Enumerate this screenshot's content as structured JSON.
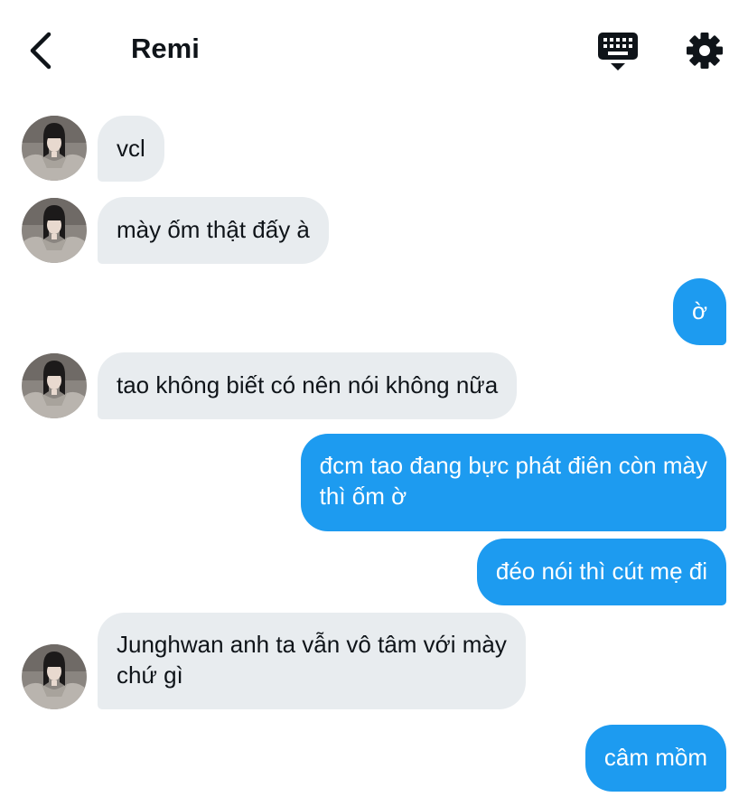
{
  "header": {
    "title": "Remi",
    "back_icon": "chevron-left-icon",
    "keyboard_icon": "keyboard-icon",
    "settings_icon": "gear-icon"
  },
  "colors": {
    "incoming_bubble": "#e8ecef",
    "outgoing_bubble": "#1d9bf0",
    "text": "#0f1419"
  },
  "messages": [
    {
      "sender": "Remi",
      "direction": "in",
      "text": "vcl"
    },
    {
      "sender": "Remi",
      "direction": "in",
      "text": "mày ốm thật đấy à"
    },
    {
      "sender": "me",
      "direction": "out",
      "text": "ờ"
    },
    {
      "sender": "Remi",
      "direction": "in",
      "text": "tao không biết có nên nói không nữa"
    },
    {
      "sender": "me",
      "direction": "out",
      "lines": [
        "đcm tao đang bực phát điên còn mày",
        "thì ốm ờ"
      ]
    },
    {
      "sender": "me",
      "direction": "out",
      "text": "đéo nói thì cút mẹ đi"
    },
    {
      "sender": "Remi",
      "direction": "in",
      "lines": [
        "Junghwan anh ta vẫn vô tâm với mày",
        "chứ gì"
      ]
    },
    {
      "sender": "me",
      "direction": "out",
      "text": "câm mồm"
    }
  ]
}
